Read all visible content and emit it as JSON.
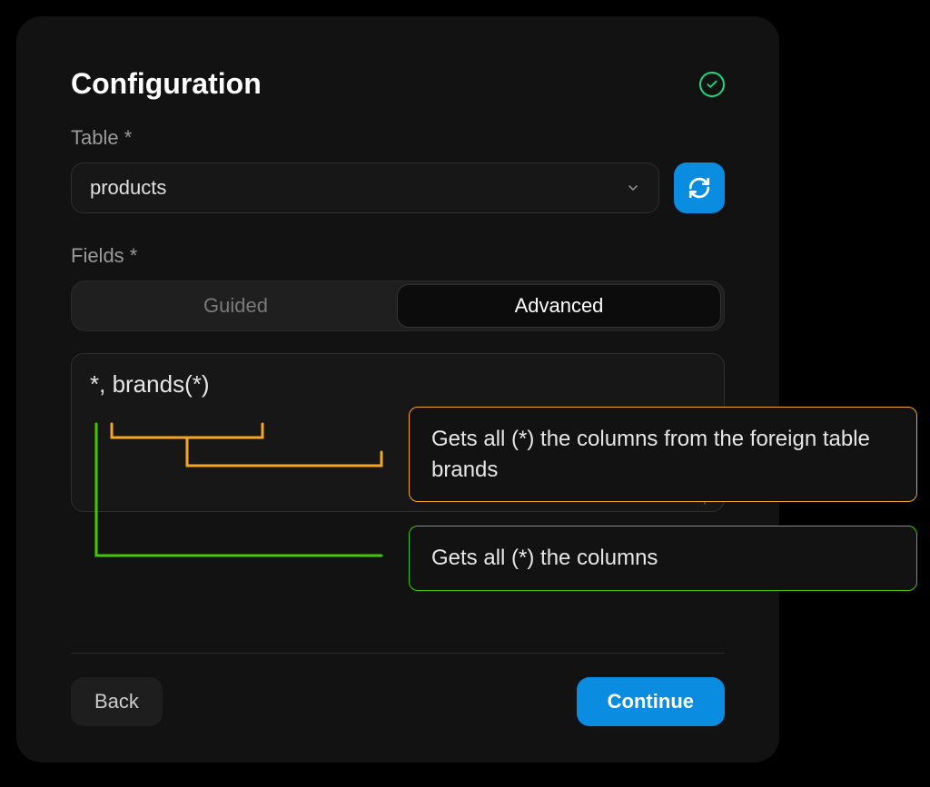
{
  "header": {
    "title": "Configuration"
  },
  "table": {
    "label": "Table *",
    "value": "products"
  },
  "fields": {
    "label": "Fields *",
    "tabs": {
      "guided": "Guided",
      "advanced": "Advanced"
    },
    "value": "*, brands(*)"
  },
  "callouts": {
    "brands": "Gets all (*) the columns from the foreign table brands",
    "star": "Gets all (*) the columns"
  },
  "buttons": {
    "back": "Back",
    "continue": "Continue"
  },
  "colors": {
    "accent_blue": "#0a8ce0",
    "accent_orange": "#f5a623",
    "accent_green": "#43c800",
    "success": "#1dd882"
  }
}
